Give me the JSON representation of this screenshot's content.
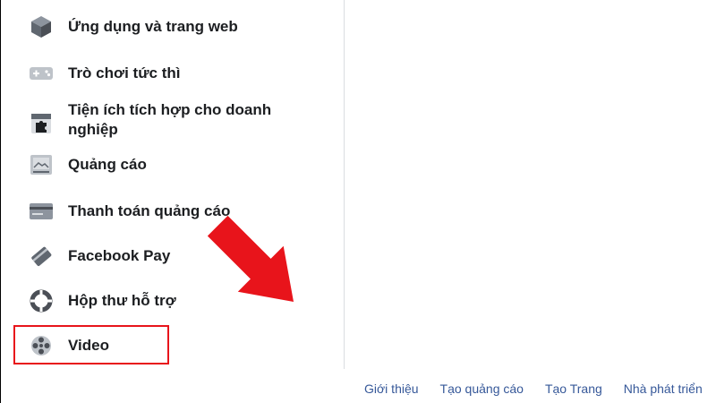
{
  "sidebar": {
    "items": [
      {
        "label": "Ứng dụng và trang web",
        "icon": "cube-icon"
      },
      {
        "label": "Trò chơi tức thì",
        "icon": "gamepad-icon"
      },
      {
        "label": "Tiện ích tích hợp cho doanh nghiệp",
        "icon": "puzzle-icon"
      },
      {
        "label": "Quảng cáo",
        "icon": "ad-image-icon"
      },
      {
        "label": "Thanh toán quảng cáo",
        "icon": "credit-card-icon"
      },
      {
        "label": "Facebook Pay",
        "icon": "payment-card-icon"
      },
      {
        "label": "Hộp thư hỗ trợ",
        "icon": "lifebuoy-icon"
      },
      {
        "label": "Video",
        "icon": "film-reel-icon"
      }
    ]
  },
  "footer": {
    "links": [
      "Giới thiệu",
      "Tạo quảng cáo",
      "Tạo Trang",
      "Nhà phát triển"
    ]
  },
  "annotation": {
    "highlight_color": "#e8141b",
    "arrow_color": "#e8141b"
  }
}
